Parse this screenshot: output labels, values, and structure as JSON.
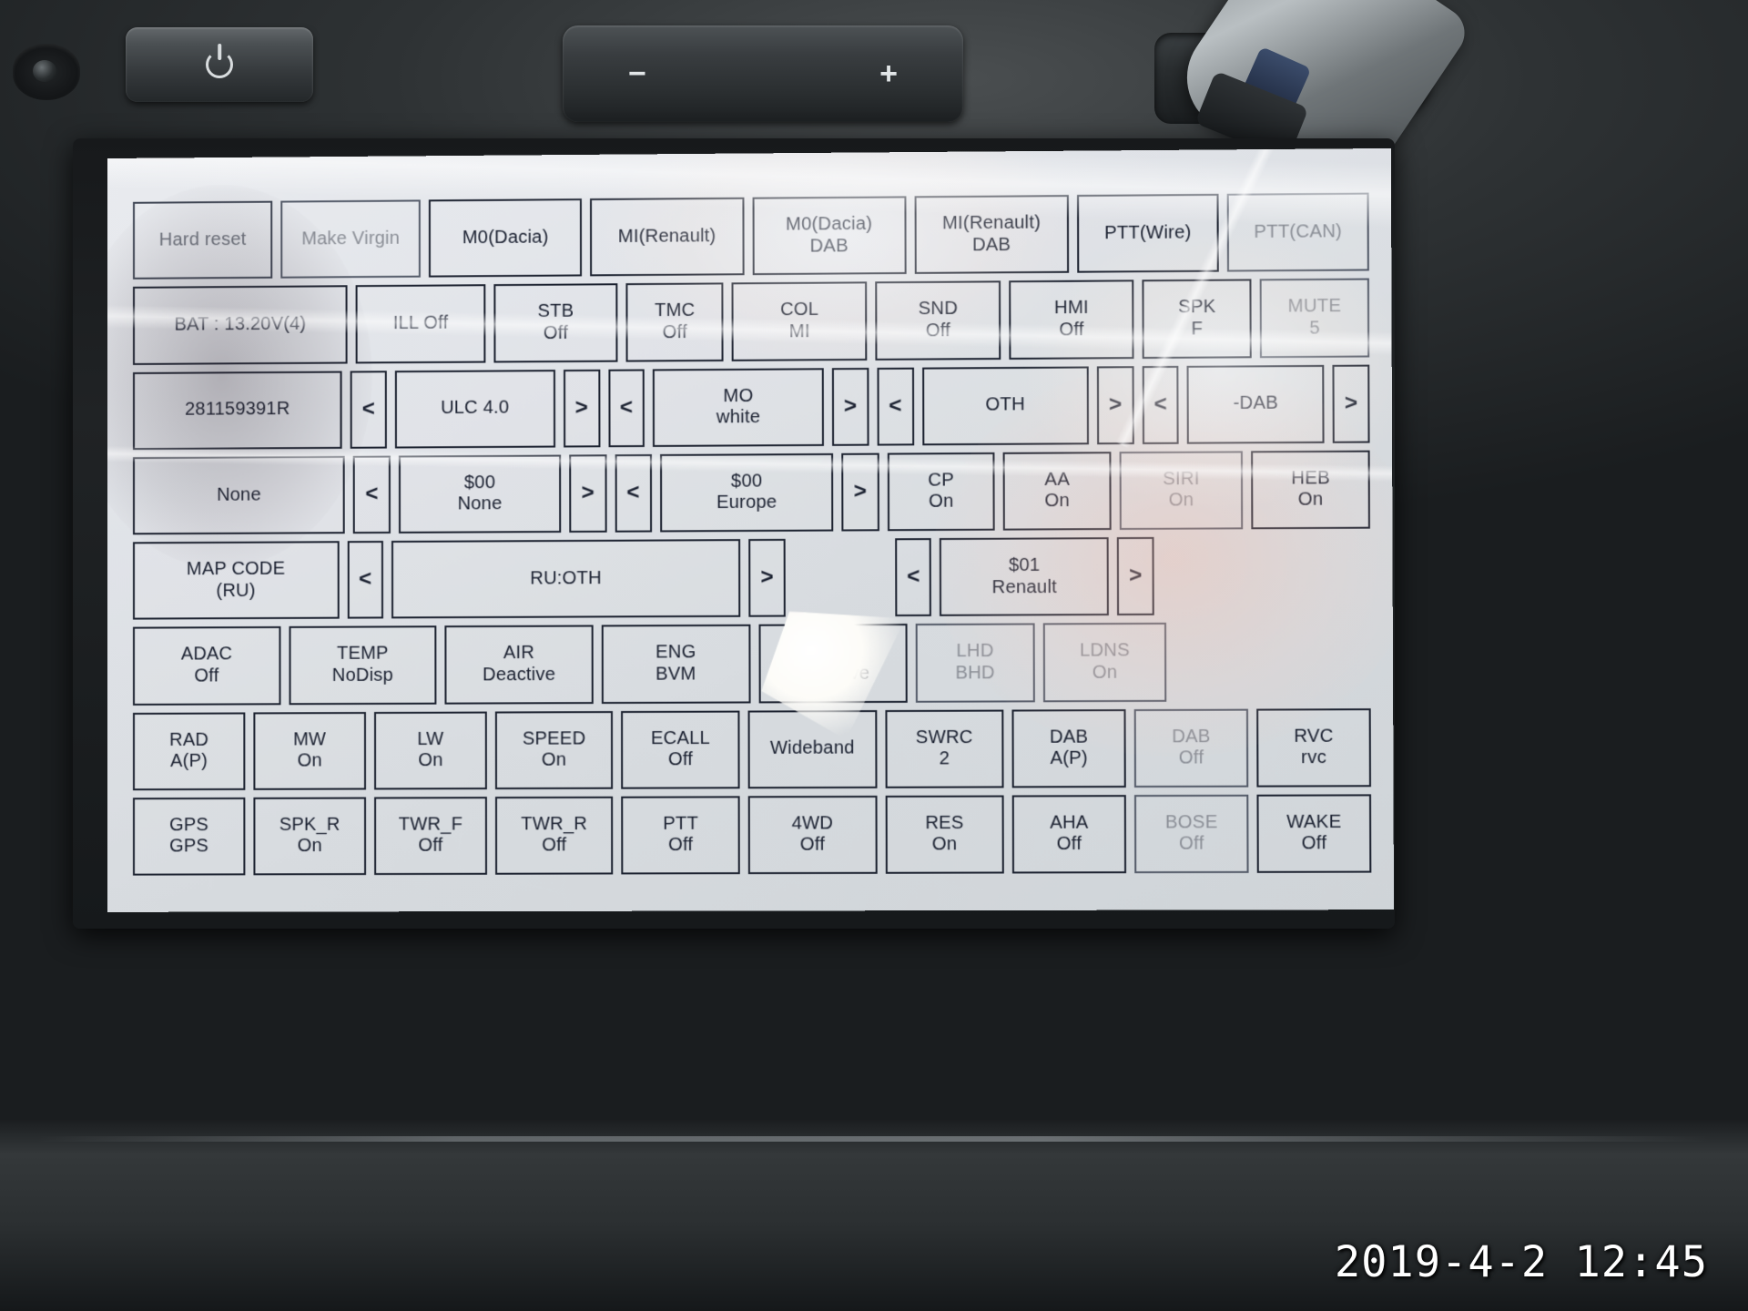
{
  "device": {
    "top_controls": {
      "power_label": "power-button",
      "volume_minus": "−",
      "volume_plus": "+"
    }
  },
  "datestamp": "2019-4-2 12:45",
  "screen": {
    "rows": [
      {
        "id": "row-mode",
        "buttons": [
          {
            "name": "hard-reset",
            "l1": "Hard reset",
            "l2": "",
            "flex": 1.0,
            "style": "faded2"
          },
          {
            "name": "make-virgin",
            "l1": "Make Virgin",
            "l2": "",
            "flex": 1.0,
            "style": "faded"
          },
          {
            "name": "m0-dacia",
            "l1": "M0(Dacia)",
            "l2": "",
            "flex": 1.1,
            "style": ""
          },
          {
            "name": "mi-renault",
            "l1": "MI(Renault)",
            "l2": "",
            "flex": 1.1,
            "style": ""
          },
          {
            "name": "m0-dacia-dab",
            "l1": "M0(Dacia)",
            "l2": "DAB",
            "flex": 1.1,
            "style": ""
          },
          {
            "name": "mi-renault-dab",
            "l1": "MI(Renault)",
            "l2": "DAB",
            "flex": 1.1,
            "style": ""
          },
          {
            "name": "ptt-wire",
            "l1": "PTT(Wire)",
            "l2": "",
            "flex": 1.0,
            "style": ""
          },
          {
            "name": "ptt-can",
            "l1": "PTT(CAN)",
            "l2": "",
            "flex": 1.0,
            "style": "faded"
          }
        ]
      },
      {
        "id": "row-status",
        "buttons": [
          {
            "name": "battery-voltage",
            "l1": "BAT :  13.20V(4)",
            "l2": "",
            "flex": 1.9,
            "style": ""
          },
          {
            "name": "illumination",
            "l1": "ILL Off",
            "l2": "",
            "flex": 1.1,
            "style": ""
          },
          {
            "name": "stb",
            "l1": "STB",
            "l2": "Off",
            "flex": 1.05,
            "style": ""
          },
          {
            "name": "tmc",
            "l1": "TMC",
            "l2": "Off",
            "flex": 0.8,
            "style": ""
          },
          {
            "name": "col",
            "l1": "COL",
            "l2": "MI",
            "flex": 1.15,
            "style": ""
          },
          {
            "name": "snd",
            "l1": "SND",
            "l2": "Off",
            "flex": 1.05,
            "style": ""
          },
          {
            "name": "hmi",
            "l1": "HMI",
            "l2": "Off",
            "flex": 1.05,
            "style": ""
          },
          {
            "name": "spk",
            "l1": "SPK",
            "l2": "F",
            "flex": 0.9,
            "style": ""
          },
          {
            "name": "mute",
            "l1": "MUTE",
            "l2": "5",
            "flex": 0.9,
            "style": "faded"
          }
        ]
      },
      {
        "id": "row-partnumber",
        "buttons": [
          {
            "name": "part-number",
            "l1": "281159391R",
            "l2": "",
            "flex": 2.0,
            "style": ""
          },
          {
            "name": "ulc-prev",
            "l1": "<",
            "l2": "",
            "flex": 0.33,
            "style": "arrow"
          },
          {
            "name": "ulc-version",
            "l1": "ULC 4.0",
            "l2": "",
            "flex": 1.5,
            "style": ""
          },
          {
            "name": "ulc-next",
            "l1": ">",
            "l2": "",
            "flex": 0.33,
            "style": "arrow"
          },
          {
            "name": "skin-prev",
            "l1": "<",
            "l2": "",
            "flex": 0.33,
            "style": "arrow"
          },
          {
            "name": "skin-value",
            "l1": "MO",
            "l2": "white",
            "flex": 1.6,
            "style": ""
          },
          {
            "name": "skin-next",
            "l1": ">",
            "l2": "",
            "flex": 0.33,
            "style": "arrow"
          },
          {
            "name": "brand-prev",
            "l1": "<",
            "l2": "",
            "flex": 0.33,
            "style": "arrow"
          },
          {
            "name": "brand-value",
            "l1": "OTH",
            "l2": "",
            "flex": 1.55,
            "style": ""
          },
          {
            "name": "brand-next",
            "l1": ">",
            "l2": "",
            "flex": 0.33,
            "style": "arrow"
          },
          {
            "name": "dab-prev",
            "l1": "<",
            "l2": "",
            "flex": 0.33,
            "style": "arrow"
          },
          {
            "name": "dab-value",
            "l1": "-DAB",
            "l2": "",
            "flex": 1.25,
            "style": ""
          },
          {
            "name": "dab-next",
            "l1": ">",
            "l2": "",
            "flex": 0.33,
            "style": "arrow"
          }
        ]
      },
      {
        "id": "row-region",
        "buttons": [
          {
            "name": "none-value",
            "l1": "None",
            "l2": "",
            "flex": 2.0,
            "style": ""
          },
          {
            "name": "code1-prev",
            "l1": "<",
            "l2": "",
            "flex": 0.33,
            "style": "arrow"
          },
          {
            "name": "code1-value",
            "l1": "$00",
            "l2": "None",
            "flex": 1.5,
            "style": ""
          },
          {
            "name": "code1-next",
            "l1": ">",
            "l2": "",
            "flex": 0.33,
            "style": "arrow"
          },
          {
            "name": "code2-prev",
            "l1": "<",
            "l2": "",
            "flex": 0.33,
            "style": "arrow"
          },
          {
            "name": "code2-value",
            "l1": "$00",
            "l2": "Europe",
            "flex": 1.6,
            "style": ""
          },
          {
            "name": "code2-next",
            "l1": ">",
            "l2": "",
            "flex": 0.33,
            "style": "arrow"
          },
          {
            "name": "cp",
            "l1": "CP",
            "l2": "On",
            "flex": 0.95,
            "style": ""
          },
          {
            "name": "aa",
            "l1": "AA",
            "l2": "On",
            "flex": 0.95,
            "style": ""
          },
          {
            "name": "siri",
            "l1": "SIRI",
            "l2": "On",
            "flex": 1.1,
            "style": "faded"
          },
          {
            "name": "heb",
            "l1": "HEB",
            "l2": "On",
            "flex": 1.05,
            "style": ""
          }
        ]
      },
      {
        "id": "row-mapcode",
        "buttons": [
          {
            "name": "map-code",
            "l1": "MAP CODE",
            "l2": "(RU)",
            "flex": 2.0,
            "style": ""
          },
          {
            "name": "mapcode-prev",
            "l1": "<",
            "l2": "",
            "flex": 0.33,
            "style": "arrow"
          },
          {
            "name": "mapcode-value",
            "l1": "RU:OTH",
            "l2": "",
            "flex": 3.45,
            "style": ""
          },
          {
            "name": "mapcode-next",
            "l1": ">",
            "l2": "",
            "flex": 0.33,
            "style": "arrow"
          },
          {
            "name": "spacer-mapcode",
            "l1": "",
            "l2": "",
            "flex": 0.95,
            "style": "spacer"
          },
          {
            "name": "oem-prev",
            "l1": "<",
            "l2": "",
            "flex": 0.33,
            "style": "arrow"
          },
          {
            "name": "oem-value",
            "l1": "$01",
            "l2": "Renault",
            "flex": 1.6,
            "style": ""
          },
          {
            "name": "oem-next",
            "l1": ">",
            "l2": "",
            "flex": 0.33,
            "style": "arrow"
          },
          {
            "name": "spacer-mapcode-2",
            "l1": "",
            "l2": "",
            "flex": 2.1,
            "style": "spacer"
          }
        ]
      },
      {
        "id": "row-vehicle",
        "buttons": [
          {
            "name": "adac",
            "l1": "ADAC",
            "l2": "Off",
            "flex": 1.35,
            "style": ""
          },
          {
            "name": "temp",
            "l1": "TEMP",
            "l2": "NoDisp",
            "flex": 1.35,
            "style": ""
          },
          {
            "name": "air",
            "l1": "AIR",
            "l2": "Deactive",
            "flex": 1.35,
            "style": ""
          },
          {
            "name": "eng",
            "l1": "ENG",
            "l2": "BVM",
            "flex": 1.35,
            "style": ""
          },
          {
            "name": "eco",
            "l1": "ECO",
            "l2": "Deactive",
            "flex": 1.35,
            "style": ""
          },
          {
            "name": "lhd",
            "l1": "LHD",
            "l2": "BHD",
            "flex": 1.05,
            "style": "faded"
          },
          {
            "name": "ldns",
            "l1": "LDNS",
            "l2": "On",
            "flex": 1.1,
            "style": "faded"
          },
          {
            "name": "spacer-vehicle",
            "l1": "",
            "l2": "",
            "flex": 1.9,
            "style": "spacer"
          }
        ]
      },
      {
        "id": "row-radio",
        "buttons": [
          {
            "name": "rad",
            "l1": "RAD",
            "l2": "A(P)",
            "flex": 1.0,
            "style": ""
          },
          {
            "name": "mw",
            "l1": "MW",
            "l2": "On",
            "flex": 1.0,
            "style": ""
          },
          {
            "name": "lw",
            "l1": "LW",
            "l2": "On",
            "flex": 1.0,
            "style": ""
          },
          {
            "name": "speed",
            "l1": "SPEED",
            "l2": "On",
            "flex": 1.05,
            "style": ""
          },
          {
            "name": "ecall",
            "l1": "ECALL",
            "l2": "Off",
            "flex": 1.05,
            "style": ""
          },
          {
            "name": "wideband",
            "l1": "Wideband",
            "l2": "",
            "flex": 1.15,
            "style": ""
          },
          {
            "name": "swrc",
            "l1": "SWRC",
            "l2": "2",
            "flex": 1.05,
            "style": ""
          },
          {
            "name": "dab-ap",
            "l1": "DAB",
            "l2": "A(P)",
            "flex": 1.0,
            "style": ""
          },
          {
            "name": "dab-off",
            "l1": "DAB",
            "l2": "Off",
            "flex": 1.0,
            "style": "faded"
          },
          {
            "name": "rvc",
            "l1": "RVC",
            "l2": "rvc",
            "flex": 1.0,
            "style": ""
          }
        ]
      },
      {
        "id": "row-misc",
        "buttons": [
          {
            "name": "gps",
            "l1": "GPS",
            "l2": "GPS",
            "flex": 1.0,
            "style": ""
          },
          {
            "name": "spk-r",
            "l1": "SPK_R",
            "l2": "On",
            "flex": 1.0,
            "style": ""
          },
          {
            "name": "twr-f",
            "l1": "TWR_F",
            "l2": "Off",
            "flex": 1.0,
            "style": ""
          },
          {
            "name": "twr-r",
            "l1": "TWR_R",
            "l2": "Off",
            "flex": 1.05,
            "style": ""
          },
          {
            "name": "ptt",
            "l1": "PTT",
            "l2": "Off",
            "flex": 1.05,
            "style": ""
          },
          {
            "name": "fourwd",
            "l1": "4WD",
            "l2": "Off",
            "flex": 1.15,
            "style": ""
          },
          {
            "name": "res",
            "l1": "RES",
            "l2": "On",
            "flex": 1.05,
            "style": ""
          },
          {
            "name": "aha",
            "l1": "AHA",
            "l2": "Off",
            "flex": 1.0,
            "style": ""
          },
          {
            "name": "bose",
            "l1": "BOSE",
            "l2": "Off",
            "flex": 1.0,
            "style": "faded"
          },
          {
            "name": "wake",
            "l1": "WAKE",
            "l2": "Off",
            "flex": 1.0,
            "style": ""
          }
        ]
      }
    ]
  }
}
